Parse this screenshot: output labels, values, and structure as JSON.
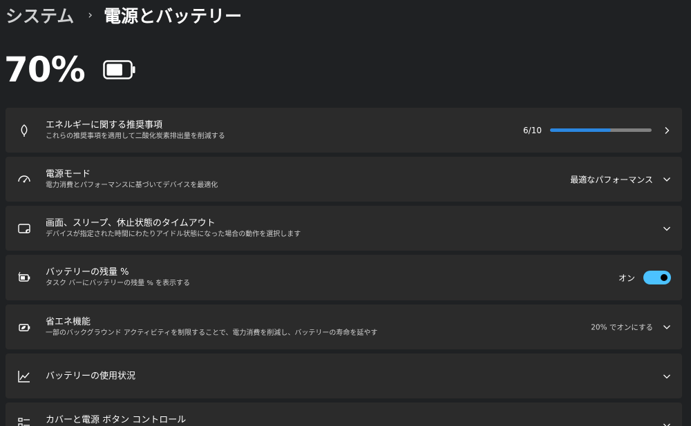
{
  "breadcrumb": {
    "parent": "システム",
    "separator": "›",
    "current": "電源とバッテリー"
  },
  "battery": {
    "percent": "70%",
    "level": 0.7
  },
  "cards": {
    "energy": {
      "title": "エネルギーに関する推奨事項",
      "description": "これらの推奨事項を適用して二酸化炭素排出量を削減する",
      "progress_label": "6/10",
      "progress_fraction": 0.6,
      "icon": "leaf-icon"
    },
    "power_mode": {
      "title": "電源モード",
      "description": "電力消費とパフォーマンスに基づいてデバイスを最適化",
      "value": "最適なパフォーマンス",
      "icon": "gauge-icon"
    },
    "screen_sleep": {
      "title": "画面、スリープ、休止状態のタイムアウト",
      "description": "デバイスが指定された時間にわたりアイドル状態になった場合の動作を選択します",
      "icon": "screen-sleep-icon"
    },
    "battery_percent": {
      "title": "バッテリーの残量 %",
      "description": "タスク バーにバッテリーの残量 % を表示する",
      "toggle_label": "オン",
      "toggle_on": true,
      "icon": "battery-charging-icon"
    },
    "energy_saver": {
      "title": "省エネ機能",
      "description": "一部のバックグラウンド アクティビティを制限することで、電力消費を削減し、バッテリーの寿命を延やす",
      "value": "20% でオンにする",
      "icon": "battery-saver-icon"
    },
    "battery_usage": {
      "title": "バッテリーの使用状況",
      "icon": "chart-line-icon"
    },
    "lid_power": {
      "title": "カバーと電源 ボタン コントロール",
      "icon": "controls-icon"
    }
  },
  "colors": {
    "background": "#1f2123",
    "card": "#2b2b2b",
    "accent": "#4cc2ff",
    "progress": "#2b87e0"
  }
}
